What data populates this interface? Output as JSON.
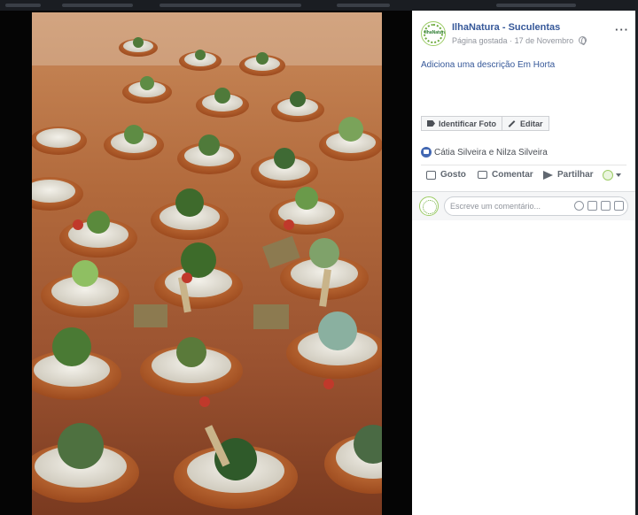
{
  "post": {
    "page_name": "IlhaNatura - Suculentas",
    "status": "Página gostada",
    "separator": "·",
    "date": "17 de Novembro",
    "avatar_text": "IlhaNatura",
    "description_prompt": "Adiciona uma descrição",
    "location": "Em Horta"
  },
  "toolbar": {
    "tag_label": "Identificar Foto",
    "edit_label": "Editar"
  },
  "reactions": {
    "likers": "Cátia Silveira e Nilza Silveira"
  },
  "actions": {
    "like": "Gosto",
    "comment": "Comentar",
    "share": "Partilhar"
  },
  "composer": {
    "placeholder": "Escreve um comentário..."
  },
  "colors": {
    "link": "#365899",
    "like_blue": "#4267b2",
    "brand_green": "#6aa83a"
  }
}
